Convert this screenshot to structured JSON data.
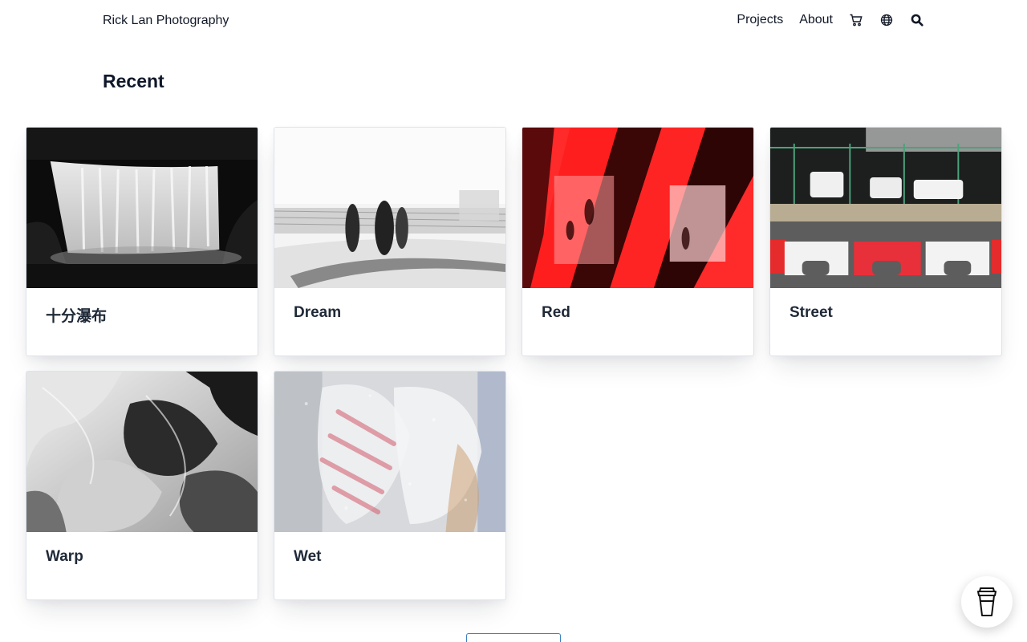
{
  "header": {
    "brand": "Rick Lan Photography",
    "nav": [
      "Projects",
      "About"
    ],
    "icons": [
      "cart-icon",
      "globe-icon",
      "search-icon"
    ]
  },
  "section": {
    "title": "Recent"
  },
  "projects": [
    {
      "title": "十分瀑布",
      "image": "waterfall-photo"
    },
    {
      "title": "Dream",
      "image": "blurred-figures-photo"
    },
    {
      "title": "Red",
      "image": "red-light-photo"
    },
    {
      "title": "Street",
      "image": "street-barriers-photo"
    },
    {
      "title": "Warp",
      "image": "warped-abstract-photo"
    },
    {
      "title": "Wet",
      "image": "wet-glass-photo"
    }
  ],
  "colors": {
    "accent": "#3b82c4",
    "text": "#111827",
    "card_border": "#dbe3ec"
  },
  "floating_button": {
    "icon": "coffee-cup-icon"
  }
}
